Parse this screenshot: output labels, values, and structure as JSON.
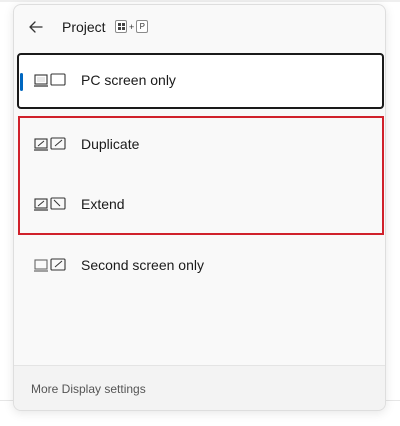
{
  "header": {
    "title": "Project",
    "shortcut_keys": [
      "windows-key",
      "P"
    ],
    "shortcut_plus": "+"
  },
  "options": [
    {
      "label": "PC screen only",
      "icon": "pc-screen-only-icon",
      "selected": true
    },
    {
      "label": "Duplicate",
      "icon": "duplicate-icon",
      "selected": false
    },
    {
      "label": "Extend",
      "icon": "extend-icon",
      "selected": false
    },
    {
      "label": "Second screen only",
      "icon": "second-screen-only-icon",
      "selected": false
    }
  ],
  "footer": {
    "link_label": "More Display settings"
  },
  "colors": {
    "accent": "#0067c0",
    "highlight": "#d0212b",
    "panel_bg": "#f9f9f9"
  }
}
